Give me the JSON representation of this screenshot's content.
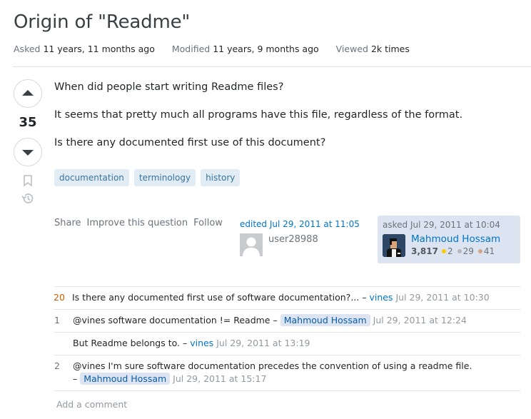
{
  "question": {
    "title": "Origin of \"Readme\"",
    "meta": {
      "asked_label": "Asked",
      "asked_value": "11 years, 11 months ago",
      "modified_label": "Modified",
      "modified_value": "11 years, 9 months ago",
      "viewed_label": "Viewed",
      "viewed_value": "2k times"
    },
    "vote_count": "35",
    "body": [
      "When did people start writing Readme files?",
      "It seems that pretty much all programs have this file, regardless of the format.",
      "Is there any documented first use of this document?"
    ],
    "tags": [
      "documentation",
      "terminology",
      "history"
    ],
    "menu": {
      "share": "Share",
      "improve": "Improve this question",
      "follow": "Follow"
    },
    "edited": {
      "when": "edited Jul 29, 2011 at 11:05",
      "user": "user28988"
    },
    "owner": {
      "when": "asked Jul 29, 2011 at 10:04",
      "name": "Mahmoud Hossam",
      "reputation": "3,817",
      "gold": "2",
      "silver": "29",
      "bronze": "41",
      "badge_colors": {
        "gold": "#ffcc01",
        "silver": "#b4b8bc",
        "bronze": "#d1a684"
      }
    }
  },
  "comments": [
    {
      "score": "20",
      "text": "Is there any documented first use of software documentation?...",
      "dash": "–",
      "user": "vines",
      "time": "Jul 29, 2011 at 10:30"
    },
    {
      "score": "1",
      "text": "@vines software documentation != Readme",
      "dash": "–",
      "user": "Mahmoud Hossam",
      "time": "Jul 29, 2011 at 12:24"
    },
    {
      "score": "",
      "text": "But Readme belongs to.",
      "dash": "–",
      "user": "vines",
      "time": "Jul 29, 2011 at 13:19"
    },
    {
      "score": "2",
      "text": "@vines I'm sure software documentation precedes the convention of using a readme file.",
      "dash": "–",
      "user": "Mahmoud Hossam",
      "time": "Jul 29, 2011 at 15:17"
    }
  ],
  "add_comment": "Add a comment",
  "colors": {
    "link": "#0074cc",
    "tag_bg": "#e1ecf4",
    "tag_text": "#39739d",
    "owner_bg": "#dbe4f0",
    "hot_score": "#c95f00"
  }
}
